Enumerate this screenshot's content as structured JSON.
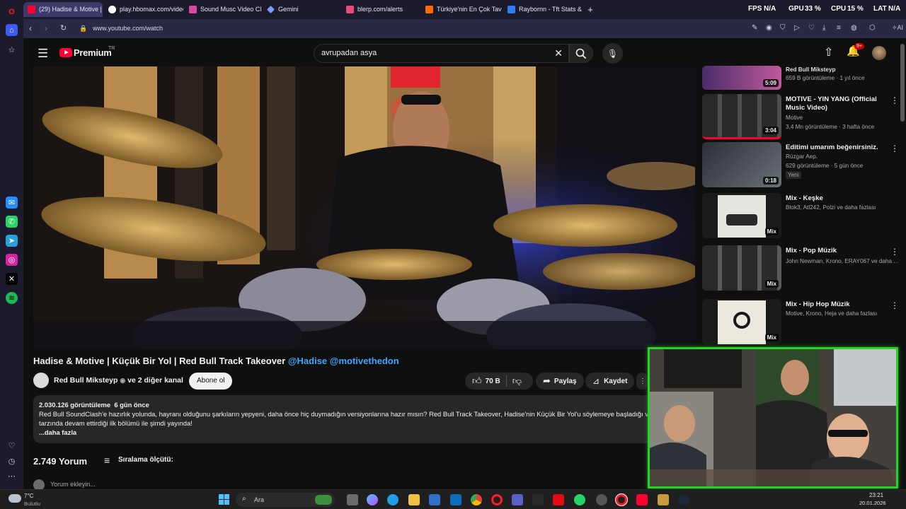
{
  "browser": {
    "tabs": [
      {
        "title": "(29) Hadise & Motive | K",
        "color": "#ff0033"
      },
      {
        "title": "play.hbomax.com/video/w",
        "color": "#ffffff"
      },
      {
        "title": "Sound Musc Video Clips -",
        "color": "#d64aa0"
      },
      {
        "title": "Gemini",
        "color": "#7d9dff"
      },
      {
        "title": "blerp.com/alerts",
        "color": "#e84a7a"
      },
      {
        "title": "Türkiye'nin En Çok Tavsiye",
        "color": "#ff6a00"
      },
      {
        "title": "Raybornn - Tft Stats & Too",
        "color": "#2f7cf6"
      }
    ],
    "new_tab": "+",
    "stats": {
      "fps_label": "FPS",
      "fps_value": "N/A",
      "gpu_label": "GPU",
      "gpu_value": "33 %",
      "cpu_label": "CPU",
      "cpu_value": "15 %",
      "lat_label": "LAT",
      "lat_value": "N/A"
    },
    "url": "www.youtube.com/watch",
    "ai_label": "AI"
  },
  "youtube": {
    "logo_text": "Premium",
    "logo_sup": "TR",
    "search_value": "avrupadan asya",
    "notif_count": "9+",
    "video_title": "Hadise & Motive | Küçük Bir Yol | Red Bull Track Takeover",
    "mention1": "@Hadise",
    "mention2": "@motivethedon",
    "channel": "Red Bull Miksteyp",
    "channel_extra": "ve 2 diğer kanal",
    "subscribe": "Abone ol",
    "likes": "70 B",
    "share": "Paylaş",
    "save": "Kaydet",
    "views": "2.030.126 görüntüleme",
    "age": "6 gün önce",
    "desc_line1": "Red Bull SoundClash'e hazırlık yolunda, hayranı olduğunu şarkıların yepyeni, daha önce hiç duymadığın versiyonlarına hazır mısın? Red Bull Track Takeover, Hadise'nin Küçük Bir Yol'u söylemeye başladığı ve Mo",
    "desc_line2": "tarzında devam ettirdiği ilk bölümü ile şimdi yayında!",
    "more": "...daha fazla",
    "comments_count": "2.749 Yorum",
    "sort_label": "Sıralama ölçütü:",
    "comment_placeholder": "Yorum ekleyin..."
  },
  "recommendations": [
    {
      "title": "",
      "channel": "Red Bull Miksteyp",
      "meta": "659 B görüntüleme · 1 yıl önce",
      "duration": "5:09",
      "thumb": "#6b3a8a"
    },
    {
      "title": "MOTIVE - YIN YANG (Official Music Video)",
      "channel": "Motive",
      "meta": "3,4 Mn görüntüleme · 3 hafta önce",
      "duration": "3:04",
      "thumb": "#3a3a3a"
    },
    {
      "title": "Editimi umarım beğenirsiniz.",
      "channel": "Rüzgar Aep.",
      "meta": "629 görüntüleme · 5 gün önce",
      "badge": "Yeni",
      "duration": "0:18",
      "thumb": "#4a4f56"
    },
    {
      "title": "Mix - Keşke",
      "channel": "Blok3, Atl242, Polzi ve daha fazlası",
      "meta": "",
      "duration": "Mix",
      "thumb": "#d9d9d6"
    },
    {
      "title": "Mix - Pop Müzik",
      "channel": "John Newman, Krono, ERAY067 ve daha ...",
      "meta": "",
      "duration": "Mix",
      "thumb": "#4a4a4a"
    },
    {
      "title": "Mix - Hip Hop Müzik",
      "channel": "Motive, Krono, Heja ve daha fazlası",
      "meta": "",
      "duration": "Mix",
      "thumb": "#e8e4da"
    }
  ],
  "taskbar": {
    "weather_temp": "7°C",
    "weather_desc": "Bulutlu",
    "search": "Ara",
    "time": "23:21",
    "date": "20.01.2026"
  }
}
